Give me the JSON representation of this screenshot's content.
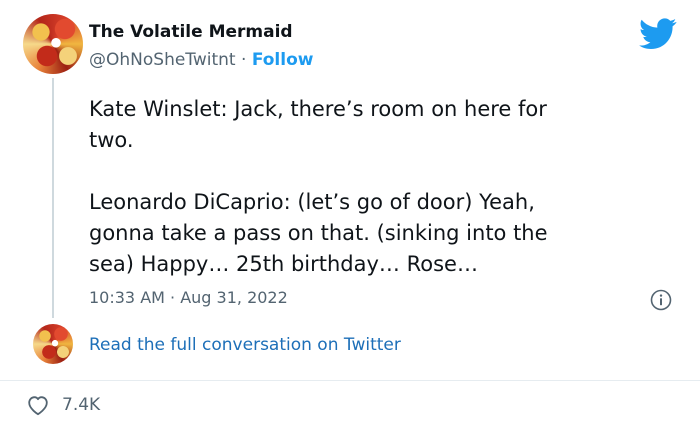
{
  "author": {
    "display_name": "The Volatile Mermaid",
    "handle": "@OhNoSheTwitnt",
    "separator": " · ",
    "follow_label": "Follow"
  },
  "tweet": {
    "text": "Kate Winslet: Jack, there’s room on here for\ntwo.\n\nLeonardo DiCaprio: (let’s go of door) Yeah,\ngonna take a pass on that. (sinking into the\nsea) Happy… 25th birthday… Rose…",
    "timestamp": "10:33 AM · Aug 31, 2022"
  },
  "conversation_link": "Read the full conversation on Twitter",
  "actions": {
    "like_count": "7.4K"
  },
  "colors": {
    "twitter_blue": "#1d9bf0",
    "link_blue": "#1d6fb8",
    "muted_text": "#536471"
  },
  "icons": {
    "brand": "twitter-bird-icon",
    "info": "info-icon",
    "like": "heart-icon"
  }
}
